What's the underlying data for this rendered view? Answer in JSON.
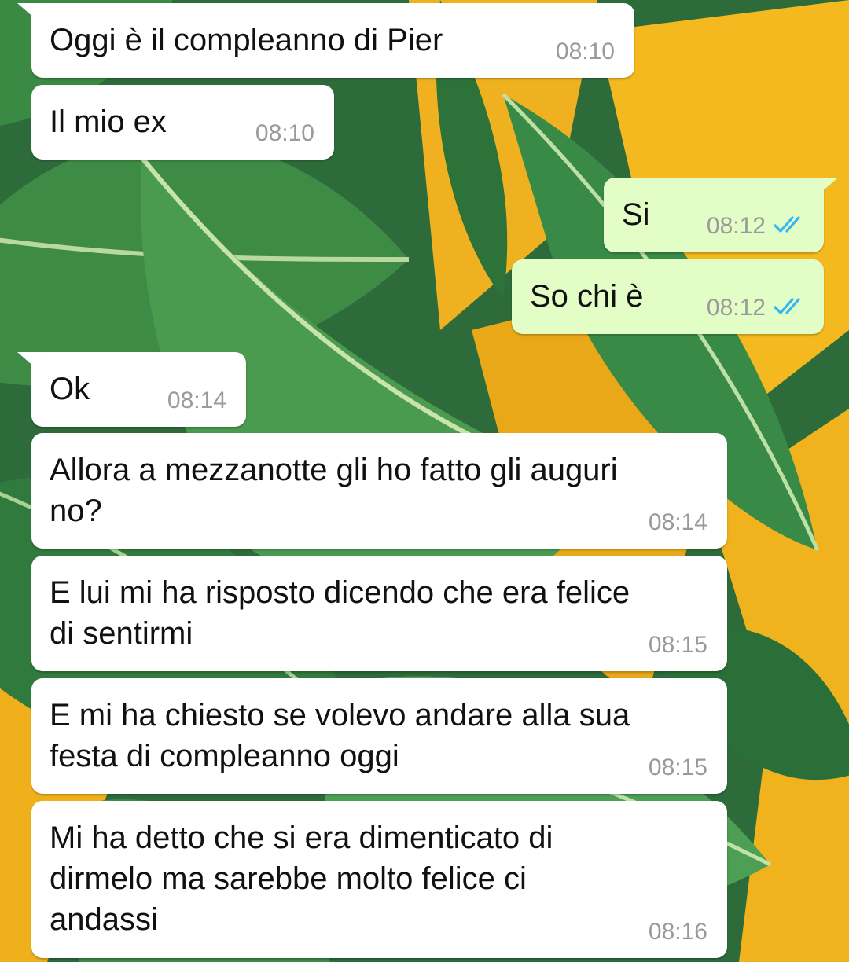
{
  "messages": [
    {
      "direction": "incoming",
      "text": "Oggi è il compleanno di Pier",
      "time": "08:10"
    },
    {
      "direction": "incoming",
      "text": "Il mio ex",
      "time": "08:10"
    },
    {
      "direction": "outgoing",
      "text": "Si",
      "time": "08:12",
      "status": "read"
    },
    {
      "direction": "outgoing",
      "text": "So chi è",
      "time": "08:12",
      "status": "read"
    },
    {
      "direction": "incoming",
      "text": "Ok",
      "time": "08:14"
    },
    {
      "direction": "incoming",
      "text": "Allora a mezzanotte gli ho fatto gli auguri\nno?",
      "time": "08:14"
    },
    {
      "direction": "incoming",
      "text": "E lui mi ha risposto dicendo che era felice\ndi sentirmi",
      "time": "08:15"
    },
    {
      "direction": "incoming",
      "text": "E mi ha chiesto se volevo andare alla sua\nfesta di compleanno oggi",
      "time": "08:15"
    },
    {
      "direction": "incoming",
      "text": "Mi ha detto che si era dimenticato di\ndirmelo ma sarebbe molto felice ci\nandassi",
      "time": "08:16"
    }
  ],
  "colors": {
    "incoming_bubble": "#ffffff",
    "outgoing_bubble": "#e2fdc6",
    "timestamp": "#9a9a9a",
    "read_ticks": "#34b7f1",
    "wallpaper_leaf": "#2f7a3e",
    "wallpaper_accent": "#f2b51d"
  },
  "icons": {
    "read_status": "double-check-icon"
  }
}
